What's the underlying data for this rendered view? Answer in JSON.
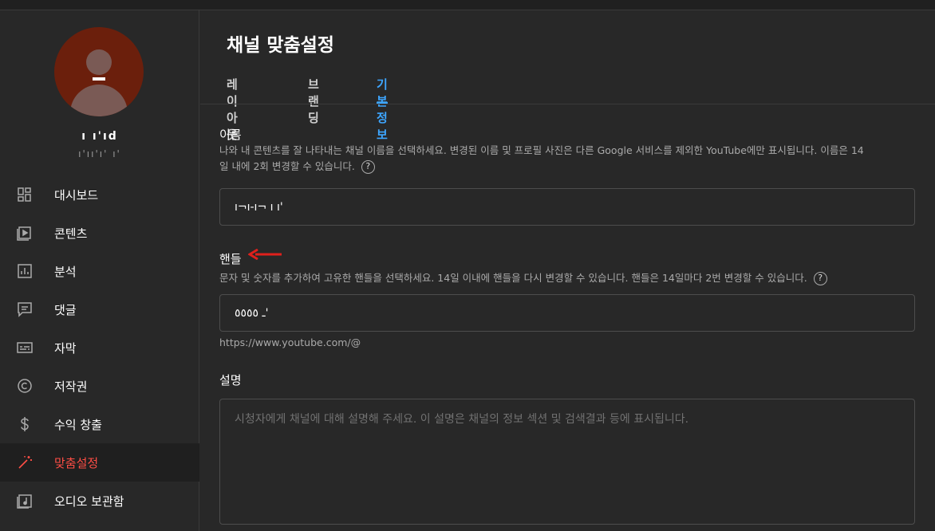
{
  "sidebar": {
    "channel_name": "ı ı'ıd",
    "channel_handle": "ı'ıı'ı' ı'",
    "items": [
      {
        "label": "대시보드",
        "icon": "dashboard-icon"
      },
      {
        "label": "콘텐츠",
        "icon": "content-icon"
      },
      {
        "label": "분석",
        "icon": "analytics-icon"
      },
      {
        "label": "댓글",
        "icon": "comments-icon"
      },
      {
        "label": "자막",
        "icon": "subtitles-icon"
      },
      {
        "label": "저작권",
        "icon": "copyright-icon"
      },
      {
        "label": "수익 창출",
        "icon": "monetization-icon"
      },
      {
        "label": "맞춤설정",
        "icon": "magic-wand-icon",
        "active": true
      },
      {
        "label": "오디오 보관함",
        "icon": "audio-library-icon"
      }
    ]
  },
  "main": {
    "title": "채널 맞춤설정",
    "tabs": [
      {
        "label": "레이아웃"
      },
      {
        "label": "브랜딩"
      },
      {
        "label": "기본 정보",
        "active": true
      }
    ],
    "name": {
      "title": "이름",
      "description_line1": "나와 내 콘텐츠를 잘 나타내는 채널 이름을 선택하세요. 변경된 이름 및 프로필 사진은 다른 Google 서비스를 제외한 YouTube에만 표시됩니다. 이름은 14",
      "description_line2": "일 내에 2회 변경할 수 있습니다.",
      "value": "ı¬ı-ı¬ ı ı'"
    },
    "handle": {
      "title": "핸들",
      "description": "문자 및 숫자를 추가하여 고유한 핸들을 선택하세요. 14일 이내에 핸들을 다시 변경할 수 있습니다. 핸들은 14일마다 2번 변경할 수 있습니다.",
      "value": "ـ ٥٥٥٥'",
      "url": "https://www.youtube.com/@"
    },
    "description": {
      "title": "설명",
      "placeholder": "시청자에게 채널에 대해 설명해 주세요. 이 설명은 채널의 정보 섹션 및 검색결과 등에 표시됩니다."
    },
    "help_icon": "?"
  },
  "colors": {
    "background": "#282828",
    "accent_tab": "#3ea6ff",
    "active_nav": "#ff4e45",
    "annotation_arrow": "#e0201c"
  }
}
